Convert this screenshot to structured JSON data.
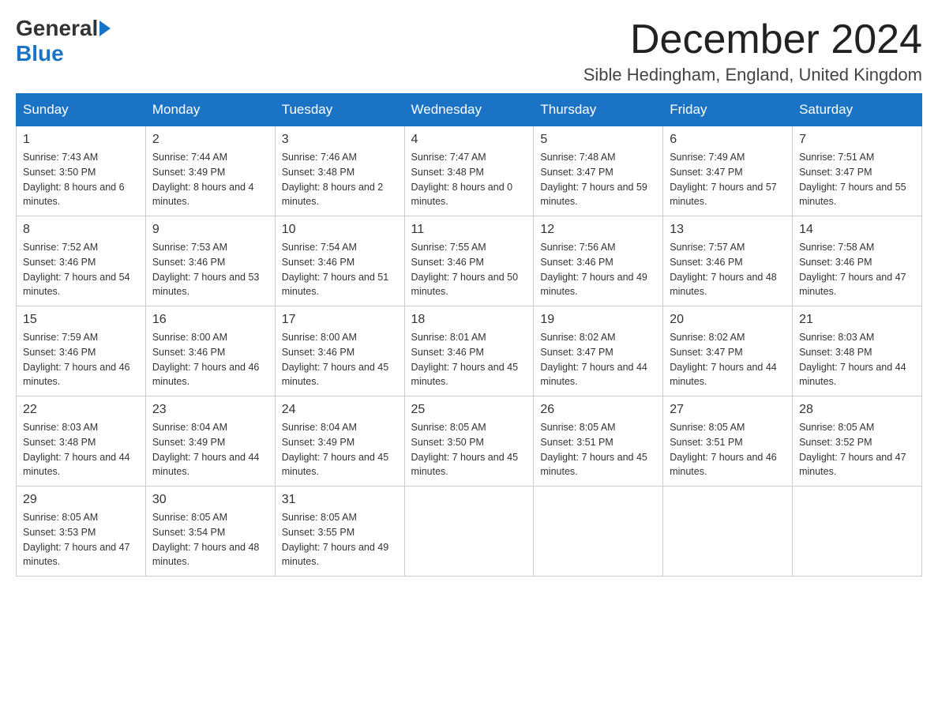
{
  "header": {
    "logo_general": "General",
    "logo_blue": "Blue",
    "title": "December 2024",
    "location": "Sible Hedingham, England, United Kingdom"
  },
  "days_of_week": [
    "Sunday",
    "Monday",
    "Tuesday",
    "Wednesday",
    "Thursday",
    "Friday",
    "Saturday"
  ],
  "weeks": [
    [
      {
        "day": 1,
        "sunrise": "7:43 AM",
        "sunset": "3:50 PM",
        "daylight": "8 hours and 6 minutes."
      },
      {
        "day": 2,
        "sunrise": "7:44 AM",
        "sunset": "3:49 PM",
        "daylight": "8 hours and 4 minutes."
      },
      {
        "day": 3,
        "sunrise": "7:46 AM",
        "sunset": "3:48 PM",
        "daylight": "8 hours and 2 minutes."
      },
      {
        "day": 4,
        "sunrise": "7:47 AM",
        "sunset": "3:48 PM",
        "daylight": "8 hours and 0 minutes."
      },
      {
        "day": 5,
        "sunrise": "7:48 AM",
        "sunset": "3:47 PM",
        "daylight": "7 hours and 59 minutes."
      },
      {
        "day": 6,
        "sunrise": "7:49 AM",
        "sunset": "3:47 PM",
        "daylight": "7 hours and 57 minutes."
      },
      {
        "day": 7,
        "sunrise": "7:51 AM",
        "sunset": "3:47 PM",
        "daylight": "7 hours and 55 minutes."
      }
    ],
    [
      {
        "day": 8,
        "sunrise": "7:52 AM",
        "sunset": "3:46 PM",
        "daylight": "7 hours and 54 minutes."
      },
      {
        "day": 9,
        "sunrise": "7:53 AM",
        "sunset": "3:46 PM",
        "daylight": "7 hours and 53 minutes."
      },
      {
        "day": 10,
        "sunrise": "7:54 AM",
        "sunset": "3:46 PM",
        "daylight": "7 hours and 51 minutes."
      },
      {
        "day": 11,
        "sunrise": "7:55 AM",
        "sunset": "3:46 PM",
        "daylight": "7 hours and 50 minutes."
      },
      {
        "day": 12,
        "sunrise": "7:56 AM",
        "sunset": "3:46 PM",
        "daylight": "7 hours and 49 minutes."
      },
      {
        "day": 13,
        "sunrise": "7:57 AM",
        "sunset": "3:46 PM",
        "daylight": "7 hours and 48 minutes."
      },
      {
        "day": 14,
        "sunrise": "7:58 AM",
        "sunset": "3:46 PM",
        "daylight": "7 hours and 47 minutes."
      }
    ],
    [
      {
        "day": 15,
        "sunrise": "7:59 AM",
        "sunset": "3:46 PM",
        "daylight": "7 hours and 46 minutes."
      },
      {
        "day": 16,
        "sunrise": "8:00 AM",
        "sunset": "3:46 PM",
        "daylight": "7 hours and 46 minutes."
      },
      {
        "day": 17,
        "sunrise": "8:00 AM",
        "sunset": "3:46 PM",
        "daylight": "7 hours and 45 minutes."
      },
      {
        "day": 18,
        "sunrise": "8:01 AM",
        "sunset": "3:46 PM",
        "daylight": "7 hours and 45 minutes."
      },
      {
        "day": 19,
        "sunrise": "8:02 AM",
        "sunset": "3:47 PM",
        "daylight": "7 hours and 44 minutes."
      },
      {
        "day": 20,
        "sunrise": "8:02 AM",
        "sunset": "3:47 PM",
        "daylight": "7 hours and 44 minutes."
      },
      {
        "day": 21,
        "sunrise": "8:03 AM",
        "sunset": "3:48 PM",
        "daylight": "7 hours and 44 minutes."
      }
    ],
    [
      {
        "day": 22,
        "sunrise": "8:03 AM",
        "sunset": "3:48 PM",
        "daylight": "7 hours and 44 minutes."
      },
      {
        "day": 23,
        "sunrise": "8:04 AM",
        "sunset": "3:49 PM",
        "daylight": "7 hours and 44 minutes."
      },
      {
        "day": 24,
        "sunrise": "8:04 AM",
        "sunset": "3:49 PM",
        "daylight": "7 hours and 45 minutes."
      },
      {
        "day": 25,
        "sunrise": "8:05 AM",
        "sunset": "3:50 PM",
        "daylight": "7 hours and 45 minutes."
      },
      {
        "day": 26,
        "sunrise": "8:05 AM",
        "sunset": "3:51 PM",
        "daylight": "7 hours and 45 minutes."
      },
      {
        "day": 27,
        "sunrise": "8:05 AM",
        "sunset": "3:51 PM",
        "daylight": "7 hours and 46 minutes."
      },
      {
        "day": 28,
        "sunrise": "8:05 AM",
        "sunset": "3:52 PM",
        "daylight": "7 hours and 47 minutes."
      }
    ],
    [
      {
        "day": 29,
        "sunrise": "8:05 AM",
        "sunset": "3:53 PM",
        "daylight": "7 hours and 47 minutes."
      },
      {
        "day": 30,
        "sunrise": "8:05 AM",
        "sunset": "3:54 PM",
        "daylight": "7 hours and 48 minutes."
      },
      {
        "day": 31,
        "sunrise": "8:05 AM",
        "sunset": "3:55 PM",
        "daylight": "7 hours and 49 minutes."
      },
      null,
      null,
      null,
      null
    ]
  ]
}
